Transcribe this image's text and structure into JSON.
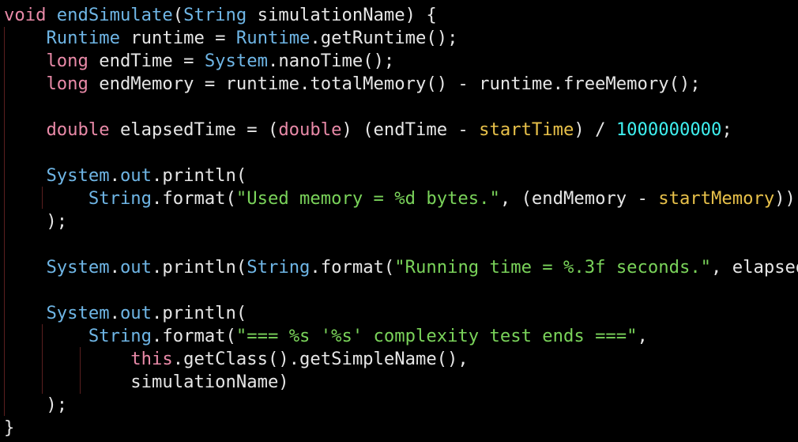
{
  "colors": {
    "background": "#000000",
    "keyword": "#e98aa8",
    "type": "#6fb6e6",
    "string": "#7ad35a",
    "number": "#3ff0f0",
    "field": "#e8c14a",
    "plain": "#e6e6e6"
  },
  "code": {
    "lines": [
      {
        "tokens": [
          {
            "t": "kw",
            "v": "void"
          },
          {
            "t": "plain",
            "v": " "
          },
          {
            "t": "fn",
            "v": "endSimulate"
          },
          {
            "t": "plain",
            "v": "("
          },
          {
            "t": "type",
            "v": "String"
          },
          {
            "t": "plain",
            "v": " simulationName) {"
          }
        ]
      },
      {
        "tokens": [
          {
            "t": "plain",
            "v": "    "
          },
          {
            "t": "type",
            "v": "Runtime"
          },
          {
            "t": "plain",
            "v": " runtime = "
          },
          {
            "t": "type",
            "v": "Runtime"
          },
          {
            "t": "plain",
            "v": ".getRuntime();"
          }
        ]
      },
      {
        "tokens": [
          {
            "t": "plain",
            "v": "    "
          },
          {
            "t": "kw",
            "v": "long"
          },
          {
            "t": "plain",
            "v": " endTime = "
          },
          {
            "t": "type",
            "v": "System"
          },
          {
            "t": "plain",
            "v": ".nanoTime();"
          }
        ]
      },
      {
        "tokens": [
          {
            "t": "plain",
            "v": "    "
          },
          {
            "t": "kw",
            "v": "long"
          },
          {
            "t": "plain",
            "v": " endMemory = runtime.totalMemory() - runtime.freeMemory();"
          }
        ]
      },
      {
        "tokens": []
      },
      {
        "tokens": [
          {
            "t": "plain",
            "v": "    "
          },
          {
            "t": "kw",
            "v": "double"
          },
          {
            "t": "plain",
            "v": " elapsedTime = ("
          },
          {
            "t": "kw",
            "v": "double"
          },
          {
            "t": "plain",
            "v": ") (endTime - "
          },
          {
            "t": "field",
            "v": "startTime"
          },
          {
            "t": "plain",
            "v": ") / "
          },
          {
            "t": "num",
            "v": "1000000000"
          },
          {
            "t": "plain",
            "v": ";"
          }
        ]
      },
      {
        "tokens": []
      },
      {
        "tokens": [
          {
            "t": "plain",
            "v": "    "
          },
          {
            "t": "type",
            "v": "System"
          },
          {
            "t": "plain",
            "v": "."
          },
          {
            "t": "type",
            "v": "out"
          },
          {
            "t": "plain",
            "v": ".println("
          }
        ]
      },
      {
        "tokens": [
          {
            "t": "plain",
            "v": "        "
          },
          {
            "t": "type",
            "v": "String"
          },
          {
            "t": "plain",
            "v": ".format("
          },
          {
            "t": "str",
            "v": "\"Used memory = %d bytes.\""
          },
          {
            "t": "plain",
            "v": ", (endMemory - "
          },
          {
            "t": "field",
            "v": "startMemory"
          },
          {
            "t": "plain",
            "v": "))"
          }
        ]
      },
      {
        "tokens": [
          {
            "t": "plain",
            "v": "    );"
          }
        ]
      },
      {
        "tokens": []
      },
      {
        "tokens": [
          {
            "t": "plain",
            "v": "    "
          },
          {
            "t": "type",
            "v": "System"
          },
          {
            "t": "plain",
            "v": "."
          },
          {
            "t": "type",
            "v": "out"
          },
          {
            "t": "plain",
            "v": ".println("
          },
          {
            "t": "type",
            "v": "String"
          },
          {
            "t": "plain",
            "v": ".format("
          },
          {
            "t": "str",
            "v": "\"Running time = %.3f seconds.\""
          },
          {
            "t": "plain",
            "v": ", elapsedTime));"
          }
        ]
      },
      {
        "tokens": []
      },
      {
        "tokens": [
          {
            "t": "plain",
            "v": "    "
          },
          {
            "t": "type",
            "v": "System"
          },
          {
            "t": "plain",
            "v": "."
          },
          {
            "t": "type",
            "v": "out"
          },
          {
            "t": "plain",
            "v": ".println("
          }
        ]
      },
      {
        "tokens": [
          {
            "t": "plain",
            "v": "        "
          },
          {
            "t": "type",
            "v": "String"
          },
          {
            "t": "plain",
            "v": ".format("
          },
          {
            "t": "str",
            "v": "\"=== %s '%s' complexity test ends ===\""
          },
          {
            "t": "plain",
            "v": ","
          }
        ]
      },
      {
        "tokens": [
          {
            "t": "plain",
            "v": "            "
          },
          {
            "t": "kw",
            "v": "this"
          },
          {
            "t": "plain",
            "v": ".getClass().getSimpleName(),"
          }
        ]
      },
      {
        "tokens": [
          {
            "t": "plain",
            "v": "            simulationName)"
          }
        ]
      },
      {
        "tokens": [
          {
            "t": "plain",
            "v": "    );"
          }
        ]
      },
      {
        "tokens": [
          {
            "t": "plain",
            "v": "}"
          }
        ]
      }
    ]
  }
}
